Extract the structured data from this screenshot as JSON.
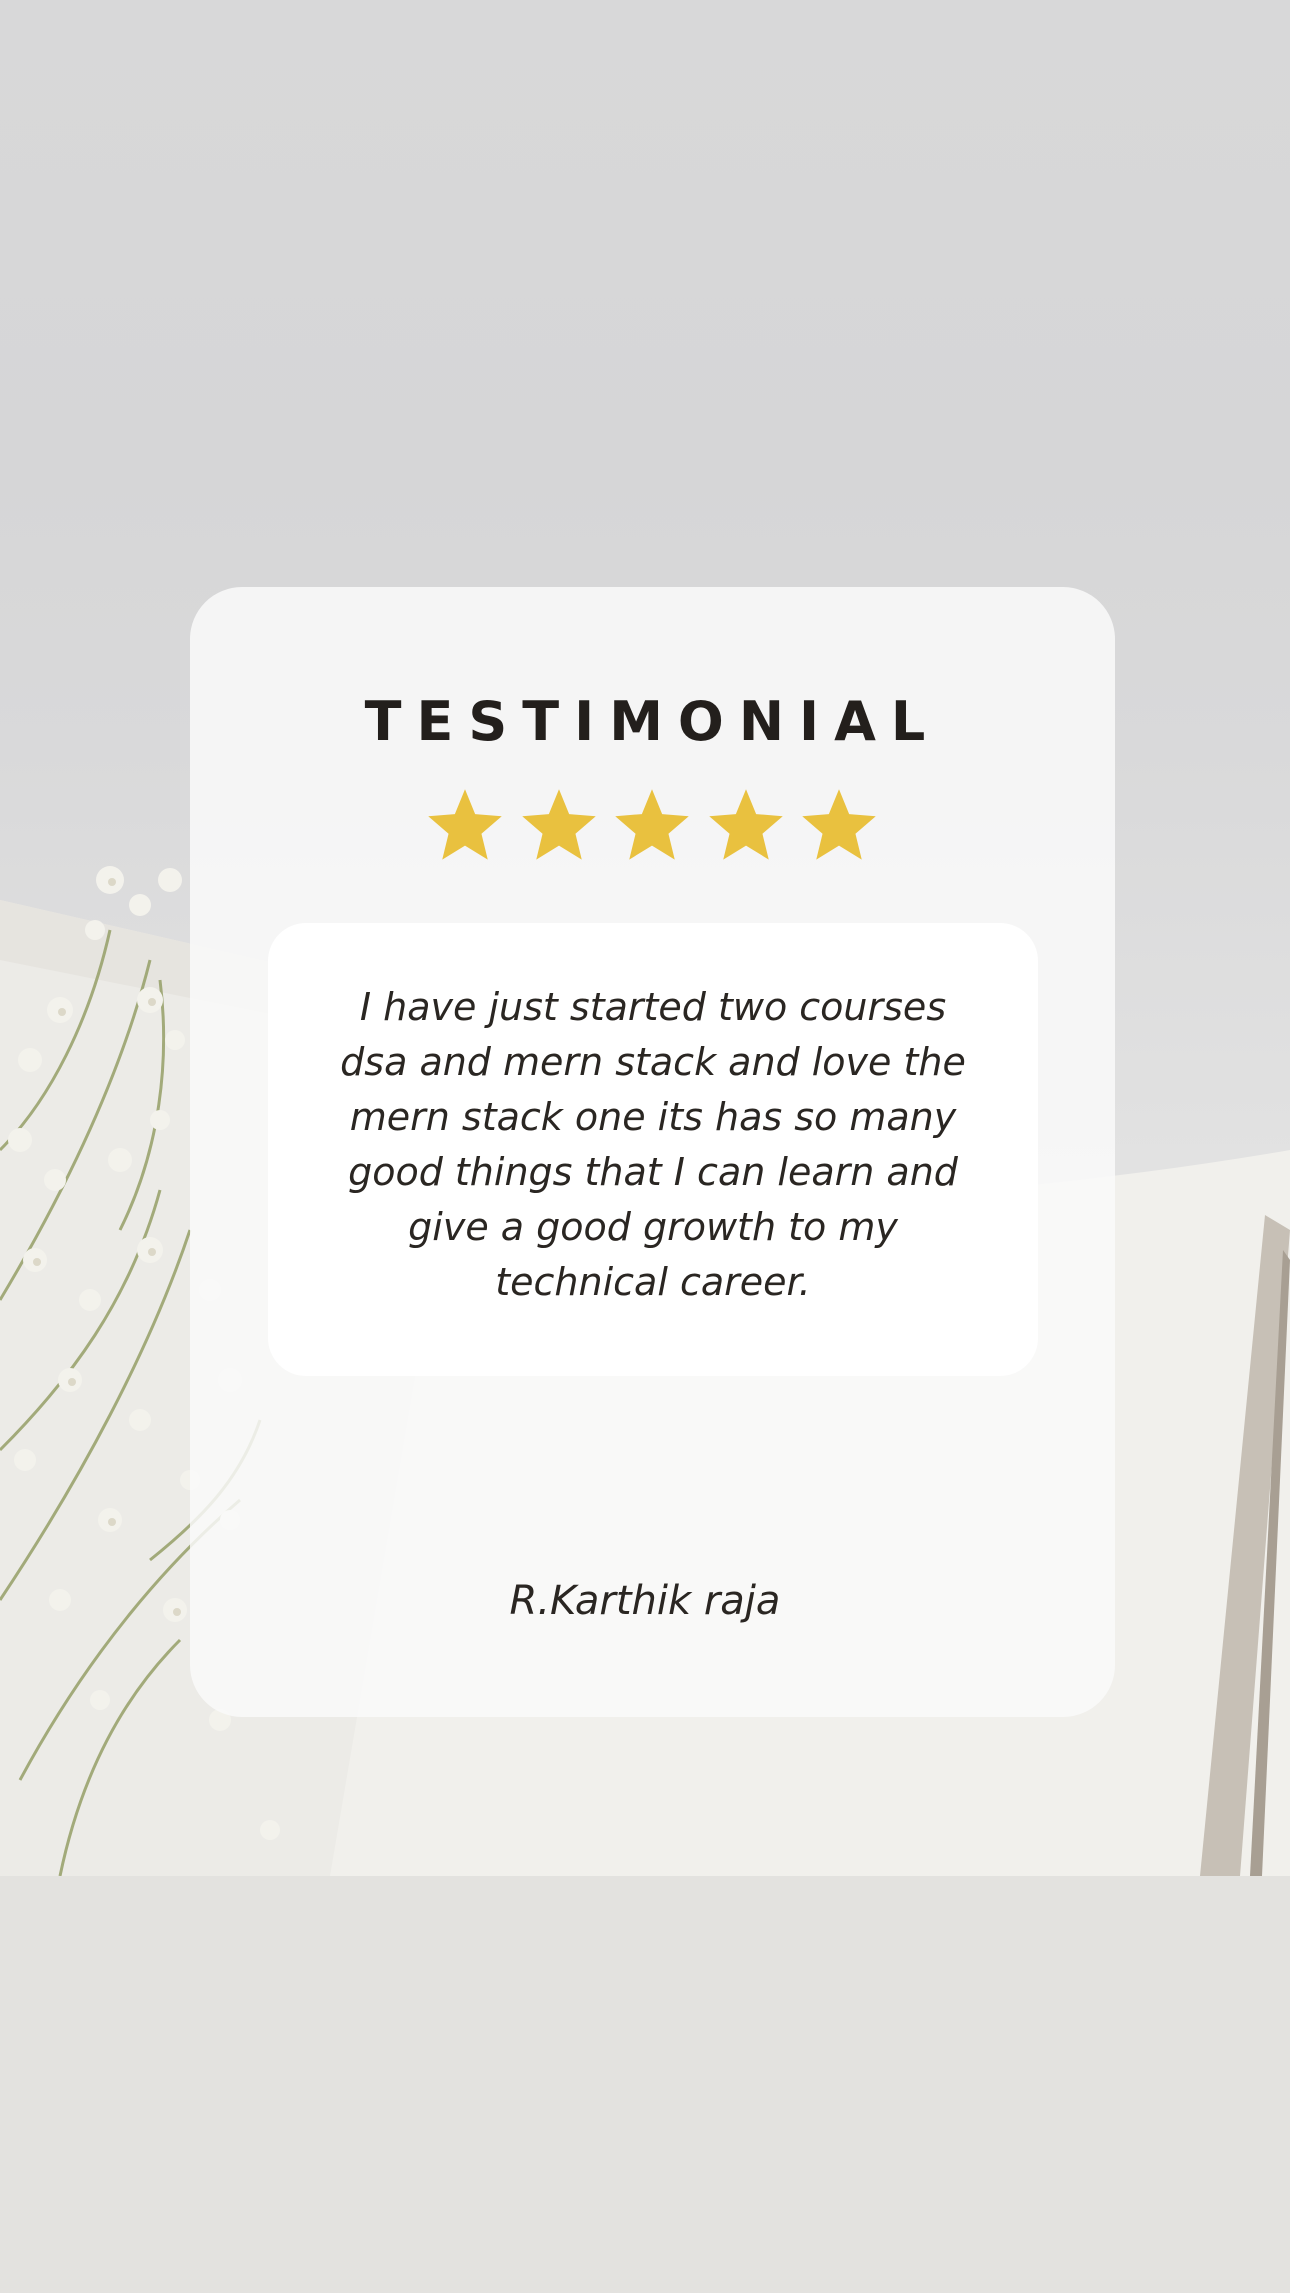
{
  "testimonial": {
    "title": "TESTIMONIAL",
    "rating": {
      "stars_filled": 5,
      "stars_total": 5,
      "star_color": "#e9c13f",
      "icon": "star-icon"
    },
    "quote": "I have just started two courses dsa and mern stack and love the mern stack one its has so many good things that I can learn and give a good growth to my technical career.",
    "author": "R.Karthik raja"
  },
  "colors": {
    "title_text": "#231f1c",
    "body_text": "#2a2622",
    "card_background": "#f7f7f7",
    "quote_background": "#ffffff"
  }
}
